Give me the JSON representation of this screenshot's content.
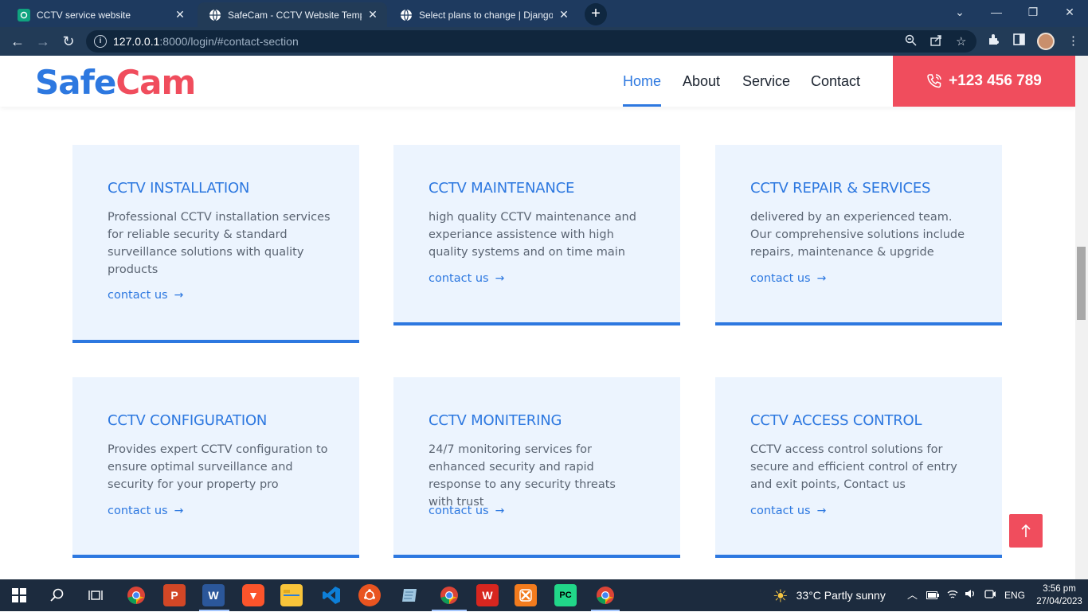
{
  "browser": {
    "tabs": [
      {
        "title": "CCTV service website",
        "close": "✕"
      },
      {
        "title": "SafeCam - CCTV Website Templa",
        "close": "✕"
      },
      {
        "title": "Select plans to change | Django s",
        "close": "✕"
      }
    ],
    "new_tab": "+",
    "url_host": "127.0.0.1",
    "url_path": ":8000/login/#contact-section"
  },
  "site": {
    "logo_part1": "Safe",
    "logo_part2": "Cam",
    "nav": [
      "Home",
      "About",
      "Service",
      "Contact"
    ],
    "phone": "+123 456 789",
    "accent": "#2d78e0",
    "brand_red": "#f04d5d"
  },
  "services": [
    {
      "title": "CCTV INSTALLATION",
      "desc": "Professional CCTV installation services for reliable security & standard surveillance solutions with quality products",
      "link": "contact us"
    },
    {
      "title": "CCTV MAINTENANCE",
      "desc": "high quality CCTV maintenance and experiance assistence with high quality systems and on time main",
      "link": "contact us"
    },
    {
      "title": "CCTV REPAIR & SERVICES",
      "desc": "delivered by an experienced team. Our comprehensive solutions include repairs, maintenance & upgride",
      "link": "contact us"
    },
    {
      "title": "CCTV CONFIGURATION",
      "desc": "Provides expert CCTV configuration to ensure optimal surveillance and security for your property pro",
      "link": "contact us"
    },
    {
      "title": "CCTV MONITERING",
      "desc": "24/7 monitoring services for enhanced security and rapid response to any security threats with trust",
      "link": "contact us"
    },
    {
      "title": "CCTV ACCESS CONTROL",
      "desc": "CCTV access control solutions for secure and efficient control of entry and exit points, Contact us",
      "link": "contact us"
    }
  ],
  "taskbar": {
    "weather": "33°C  Partly sunny",
    "lang": "ENG",
    "time": "3:56 pm",
    "date": "27/04/2023"
  }
}
